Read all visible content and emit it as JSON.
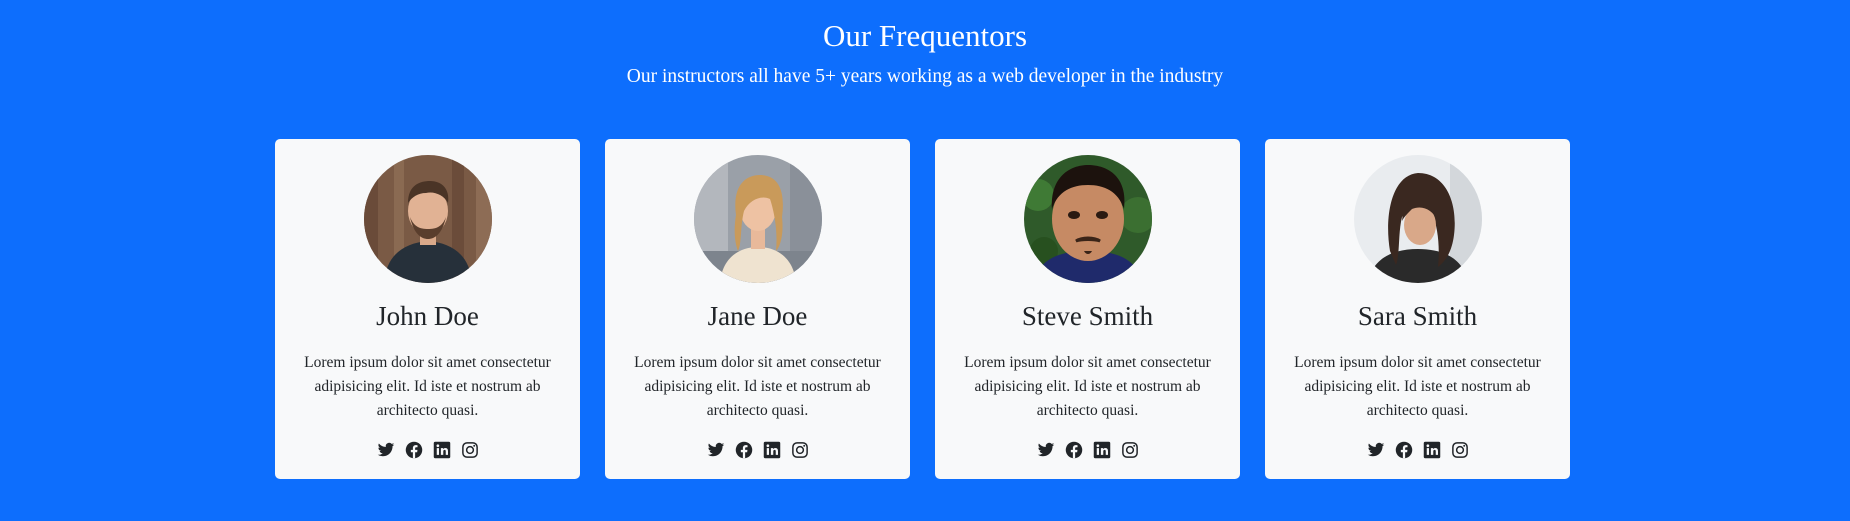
{
  "section": {
    "title": "Our Frequentors",
    "subtitle": "Our instructors all have 5+ years working as a web developer in the industry"
  },
  "instructors": [
    {
      "name": "John Doe",
      "bio": "Lorem ipsum dolor sit amet consectetur adipisicing elit. Id iste et nostrum ab architecto quasi.",
      "photo": "man-beard-dark-shirt-wood-background",
      "social": [
        "twitter-icon",
        "facebook-icon",
        "linkedin-icon",
        "instagram-icon"
      ]
    },
    {
      "name": "Jane Doe",
      "bio": "Lorem ipsum dolor sit amet consectetur adipisicing elit. Id iste et nostrum ab architecto quasi.",
      "photo": "woman-blonde-street",
      "social": [
        "twitter-icon",
        "facebook-icon",
        "linkedin-icon",
        "instagram-icon"
      ]
    },
    {
      "name": "Steve Smith",
      "bio": "Lorem ipsum dolor sit amet consectetur adipisicing elit. Id iste et nostrum ab architecto quasi.",
      "photo": "man-selfie-green-background",
      "social": [
        "twitter-icon",
        "facebook-icon",
        "linkedin-icon",
        "instagram-icon"
      ]
    },
    {
      "name": "Sara Smith",
      "bio": "Lorem ipsum dolor sit amet consectetur adipisicing elit. Id iste et nostrum ab architecto quasi.",
      "photo": "woman-dark-hair-looking-down",
      "social": [
        "twitter-icon",
        "facebook-icon",
        "linkedin-icon",
        "instagram-icon"
      ]
    }
  ],
  "colors": {
    "background": "#0d6efd",
    "card": "#f8f9fa",
    "text": "#212529",
    "heading_text": "#ffffff"
  }
}
